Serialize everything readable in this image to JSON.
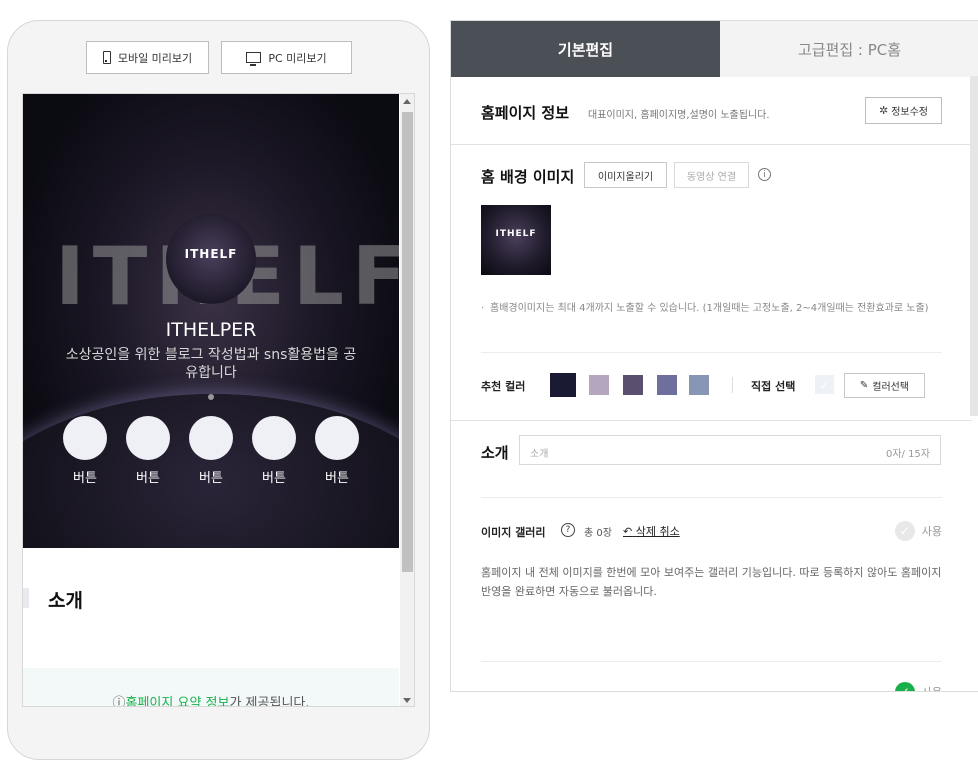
{
  "preview": {
    "mobile_button": "모바일 미리보기",
    "pc_button": "PC 미리보기",
    "hero": {
      "big_text": "ITHELF",
      "logo_text": "ITHELF",
      "title": "ITHELPER",
      "description": "소상공인을 위한 블로그 작성법과 sns활용법을 공유합니다",
      "buttons": [
        "버튼",
        "버튼",
        "버튼",
        "버튼",
        "버튼"
      ]
    },
    "intro_heading": "소개",
    "summary_prefix": "ⓘ",
    "summary_link": "홈페이지 요약 정보",
    "summary_suffix": "가 제공됩니다."
  },
  "tabs": {
    "basic": "기본편집",
    "advanced": "고급편집 : PC홈"
  },
  "homepage_info": {
    "title": "홈페이지 정보",
    "subtitle": "대표이미지, 홈페이지명,설명이 노출됩니다.",
    "edit_icon": "gear-icon",
    "edit_button": "정보수정"
  },
  "background": {
    "title": "홈 배경 이미지",
    "upload_button": "이미지올리기",
    "video_button": "동영상 연결",
    "info_glyph": "i",
    "thumbnail_text": "ITHELF",
    "note": "홈배경이미지는 최대 4개까지 노출할 수 있습니다. (1개일때는 고정노출, 2~4개일때는 전환효과로 노출)",
    "recommend_label": "추천 컬러",
    "swatches": [
      "#1b1a33",
      "#b3a6be",
      "#5a4f6e",
      "#6f6f9e",
      "#8796b4"
    ],
    "direct_label": "직접 선택",
    "check_glyph": "✓",
    "picker_icon": "eyedropper-icon",
    "picker_button": "컬러선택"
  },
  "intro": {
    "title": "소개",
    "placeholder": "소개",
    "counter": "0자/ 15자"
  },
  "gallery": {
    "title": "이미지 갤러리",
    "help_glyph": "?",
    "count": "총 0장",
    "undo_icon": "undo-icon",
    "undo_label": "삭제 취소",
    "use_label": "사용",
    "description": "홈페이지 내 전체 이미지를 한번에 모아 보여주는 갤러리 기능입니다. 따로 등록하지 않아도 홈페이지 반영을 완료하면 자동으로 불러옵니다."
  },
  "next_item": {
    "use_label": "사용"
  }
}
